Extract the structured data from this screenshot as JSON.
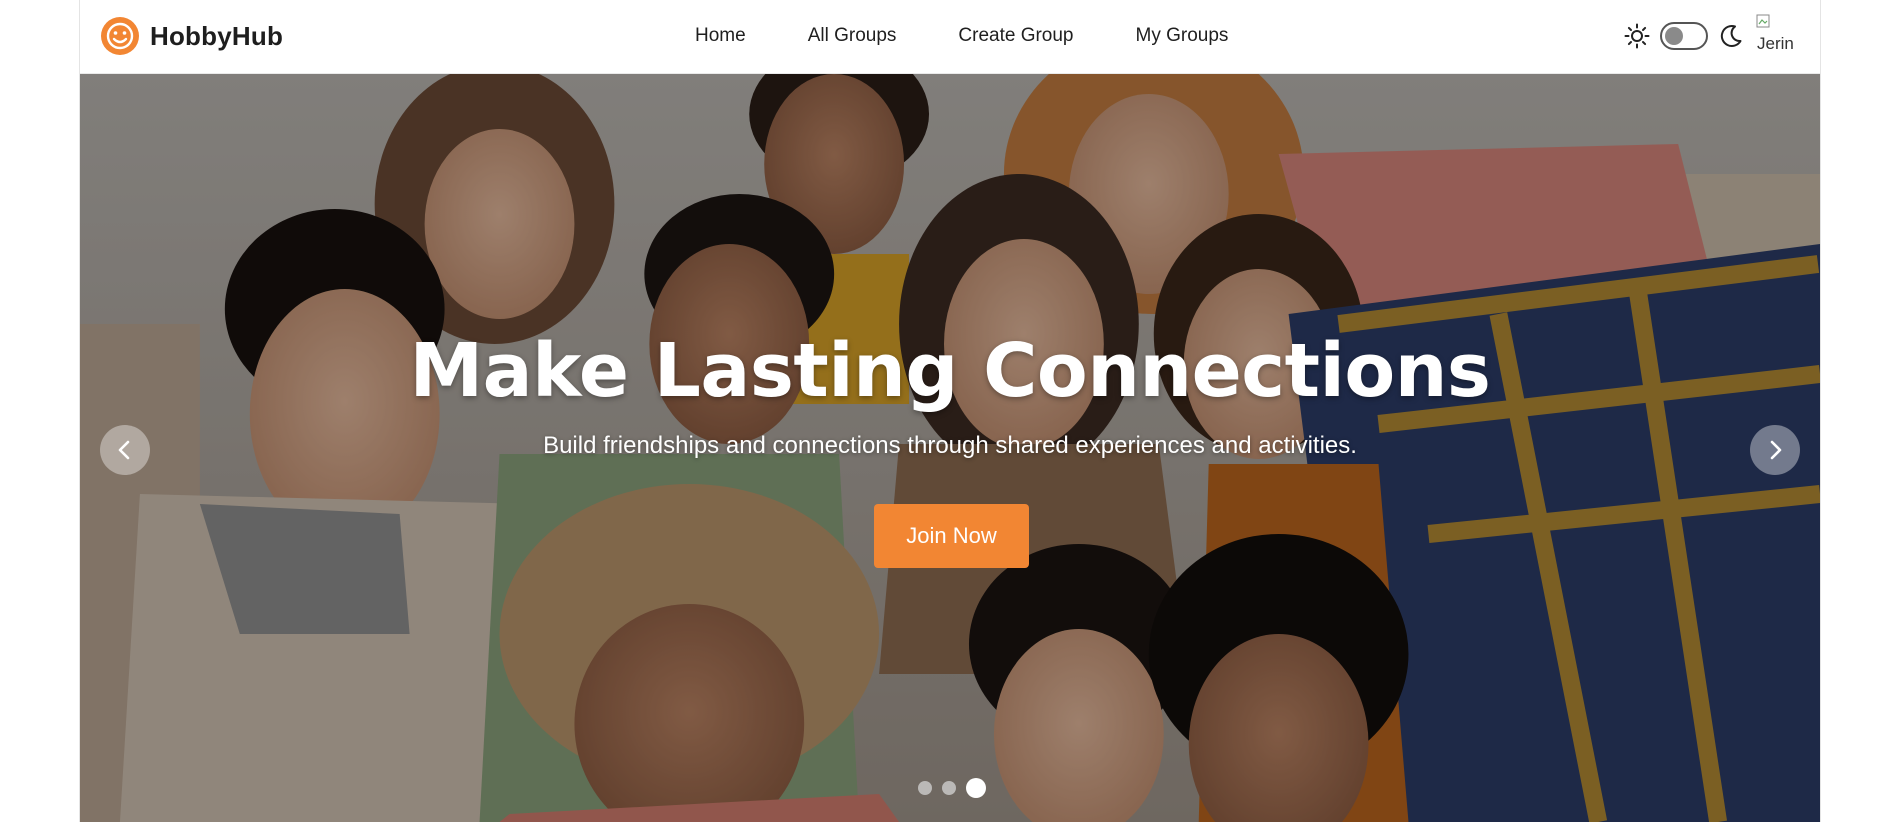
{
  "brand": {
    "name": "HobbyHub",
    "icon": "smiley-logo-icon",
    "color": "#f28633"
  },
  "nav": {
    "links": [
      "Home",
      "All Groups",
      "Create Group",
      "My Groups"
    ]
  },
  "theme_toggle": {
    "light_icon": "sun-icon",
    "dark_icon": "moon-icon",
    "state": "light"
  },
  "user": {
    "avatar_alt": "Jerin"
  },
  "hero": {
    "title": "Make Lasting Connections",
    "subtitle": "Build friendships and connections through shared experiences and activities.",
    "cta_label": "Join Now",
    "cta_color": "#f28633",
    "prev_icon": "chevron-left-icon",
    "next_icon": "chevron-right-icon",
    "slides": 3,
    "active_slide": 3
  }
}
